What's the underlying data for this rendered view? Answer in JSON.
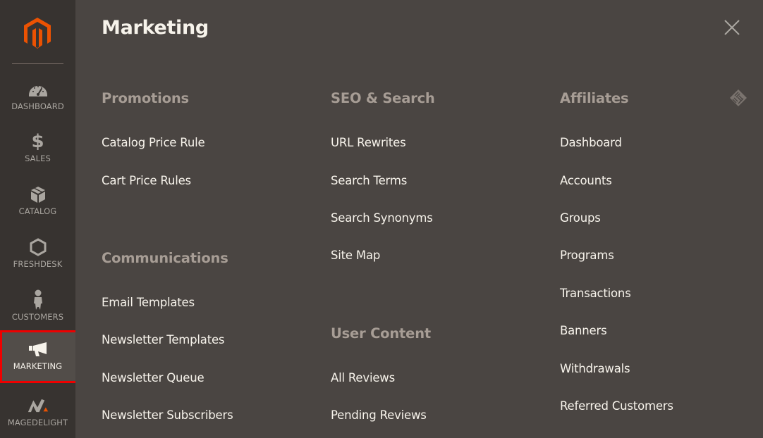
{
  "colors": {
    "sidebar_bg": "#373330",
    "panel_bg": "#4a4542",
    "active_bg": "#524d49",
    "highlight_border": "#ee0000",
    "brand_orange": "#eb5202",
    "section_title": "#a79d95",
    "link_text": "#f7f3eb"
  },
  "sidebar": {
    "logo": "magento-logo-icon",
    "items": [
      {
        "label": "DASHBOARD",
        "icon": "speedometer-icon",
        "active": false
      },
      {
        "label": "SALES",
        "icon": "dollar-icon",
        "active": false
      },
      {
        "label": "CATALOG",
        "icon": "box-icon",
        "active": false
      },
      {
        "label": "FRESHDESK",
        "icon": "hexagon-icon",
        "active": false
      },
      {
        "label": "CUSTOMERS",
        "icon": "person-icon",
        "active": false
      },
      {
        "label": "MARKETING",
        "icon": "megaphone-icon",
        "active": true
      },
      {
        "label": "MAGEDELIGHT",
        "icon": "magedelight-icon",
        "active": false
      }
    ]
  },
  "panel": {
    "title": "Marketing",
    "close_icon": "close-icon",
    "columns": [
      {
        "sections": [
          {
            "title": "Promotions",
            "items": [
              "Catalog Price Rule",
              "Cart Price Rules"
            ]
          },
          {
            "title": "Communications",
            "items": [
              "Email Templates",
              "Newsletter Templates",
              "Newsletter Queue",
              "Newsletter Subscribers"
            ]
          }
        ]
      },
      {
        "sections": [
          {
            "title": "SEO & Search",
            "items": [
              "URL Rewrites",
              "Search Terms",
              "Search Synonyms",
              "Site Map"
            ]
          },
          {
            "title": "User Content",
            "items": [
              "All Reviews",
              "Pending Reviews"
            ]
          }
        ]
      },
      {
        "sections": [
          {
            "title": "Affiliates",
            "items": [
              "Dashboard",
              "Accounts",
              "Groups",
              "Programs",
              "Transactions",
              "Banners",
              "Withdrawals",
              "Referred Customers"
            ]
          }
        ]
      }
    ],
    "extension_icon": "affiliate-extension-icon"
  }
}
